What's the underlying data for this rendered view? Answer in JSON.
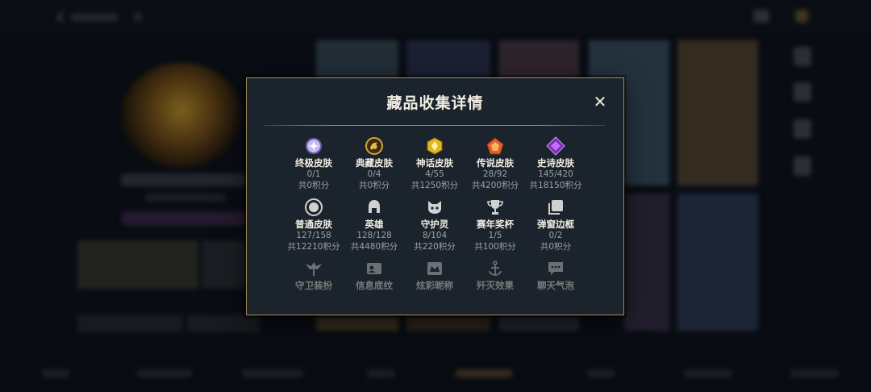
{
  "modal": {
    "title": "藏品收集详情",
    "close_glyph": "✕"
  },
  "categories": [
    {
      "name": "终极皮肤",
      "count": "0/1",
      "score": "共0积分",
      "icon": "ultimate-skin-icon",
      "color": "#b7a6e8"
    },
    {
      "name": "典藏皮肤",
      "count": "0/4",
      "score": "共0积分",
      "icon": "treasure-skin-icon",
      "color": "#d8a23a"
    },
    {
      "name": "神话皮肤",
      "count": "4/55",
      "score": "共1250积分",
      "icon": "mythic-skin-icon",
      "color": "#e0b624"
    },
    {
      "name": "传说皮肤",
      "count": "28/92",
      "score": "共4200积分",
      "icon": "legendary-skin-icon",
      "color": "#e0602a"
    },
    {
      "name": "史诗皮肤",
      "count": "145/420",
      "score": "共18150积分",
      "icon": "epic-skin-icon",
      "color": "#a445d8"
    },
    {
      "name": "普通皮肤",
      "count": "127/158",
      "score": "共12210积分",
      "icon": "normal-skin-icon",
      "color": "#c8c8c8"
    },
    {
      "name": "英雄",
      "count": "128/128",
      "score": "共4480积分",
      "icon": "hero-icon",
      "color": "#c8c8c8"
    },
    {
      "name": "守护灵",
      "count": "8/104",
      "score": "共220积分",
      "icon": "guardian-spirit-icon",
      "color": "#c8c8c8"
    },
    {
      "name": "赛年奖杯",
      "count": "1/5",
      "score": "共100积分",
      "icon": "trophy-icon",
      "color": "#c8c8c8"
    },
    {
      "name": "弹窗边框",
      "count": "0/2",
      "score": "共0积分",
      "icon": "popup-frame-icon",
      "color": "#c8c8c8"
    },
    {
      "name": "守卫装扮",
      "count": "",
      "score": "",
      "icon": "ward-skin-icon",
      "color": "#c8c8c8"
    },
    {
      "name": "信息底纹",
      "count": "",
      "score": "",
      "icon": "info-card-icon",
      "color": "#c8c8c8"
    },
    {
      "name": "炫彩昵称",
      "count": "",
      "score": "",
      "icon": "nickname-icon",
      "color": "#c8c8c8"
    },
    {
      "name": "歼灭效果",
      "count": "",
      "score": "",
      "icon": "elimination-effect-icon",
      "color": "#c8c8c8"
    },
    {
      "name": "聊天气泡",
      "count": "",
      "score": "",
      "icon": "chat-bubble-icon",
      "color": "#c8c8c8"
    }
  ]
}
